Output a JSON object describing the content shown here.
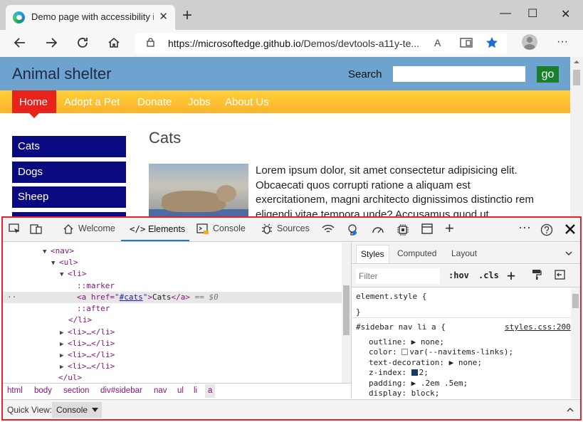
{
  "browser": {
    "tab_title": "Demo page with accessibility issu",
    "tab_close": "✕",
    "new_tab": "+",
    "minimize": "—",
    "maximize": "☐",
    "close": "✕",
    "url_host": "https://microsoftedge.github.io",
    "url_path": "/Demos/devtools-a11y-te...",
    "read_aloud": "A",
    "more": "···"
  },
  "site": {
    "title": "Animal shelter",
    "search_label": "Search",
    "search_value": "",
    "go_label": "go",
    "menu": [
      "Home",
      "Adopt a Pet",
      "Donate",
      "Jobs",
      "About Us"
    ],
    "sidebar": [
      "Cats",
      "Dogs",
      "Sheep"
    ],
    "heading": "Cats",
    "lorem": "Lorem ipsum dolor, sit amet consectetur adipisicing elit. Obcaecati quos corrupti ratione a aliquam est exercitationem, magni architecto dignissimos distinctio rem eligendi vitae tempora unde? Accusamus quod ut"
  },
  "devtools": {
    "tabs": [
      "Welcome",
      "Elements",
      "Console",
      "Sources"
    ],
    "active_tab": "Elements",
    "dom": {
      "nav": "<nav>",
      "ul": "<ul>",
      "li": "<li>",
      "marker": "::marker",
      "a_open": "<a href=",
      "a_href": "#cats",
      "a_text": "Cats",
      "a_close": "</a>",
      "eq": "== $0",
      "after": "::after",
      "li_close": "</li>",
      "li_collapsed": "<li>…</li>",
      "ul_close": "</ul>",
      "dots": "··"
    },
    "breadcrumbs": [
      "html",
      "body",
      "section",
      "div#sidebar",
      "nav",
      "ul",
      "li",
      "a"
    ],
    "styles_tabs": [
      "Styles",
      "Computed",
      "Layout"
    ],
    "filter_placeholder": "Filter",
    "hov": ":hov",
    "cls": ".cls",
    "element_style": "element.style {",
    "close_brace": "}",
    "rule_selector": "#sidebar nav li a {",
    "rule_source": "styles.css:200",
    "declarations": [
      {
        "prop": "outline",
        "value": "none;"
      },
      {
        "prop": "color",
        "value": "var(--navitems-links);"
      },
      {
        "prop": "text-decoration",
        "value": "none;"
      },
      {
        "prop": "z-index",
        "value": "2;"
      },
      {
        "prop": "padding",
        "value": ".2em .5em;"
      },
      {
        "prop": "display",
        "value": "block;"
      }
    ],
    "quick_view_label": "Quick View:",
    "quick_view_value": "Console"
  },
  "colors": {
    "header_bg": "#6fa3cf",
    "menu_bg": "#fbb42a",
    "home_bg": "#e8231c",
    "sidebar_bg": "#0a0a80",
    "go_bg": "#1a7f2b",
    "devtools_border": "#e0262b"
  }
}
